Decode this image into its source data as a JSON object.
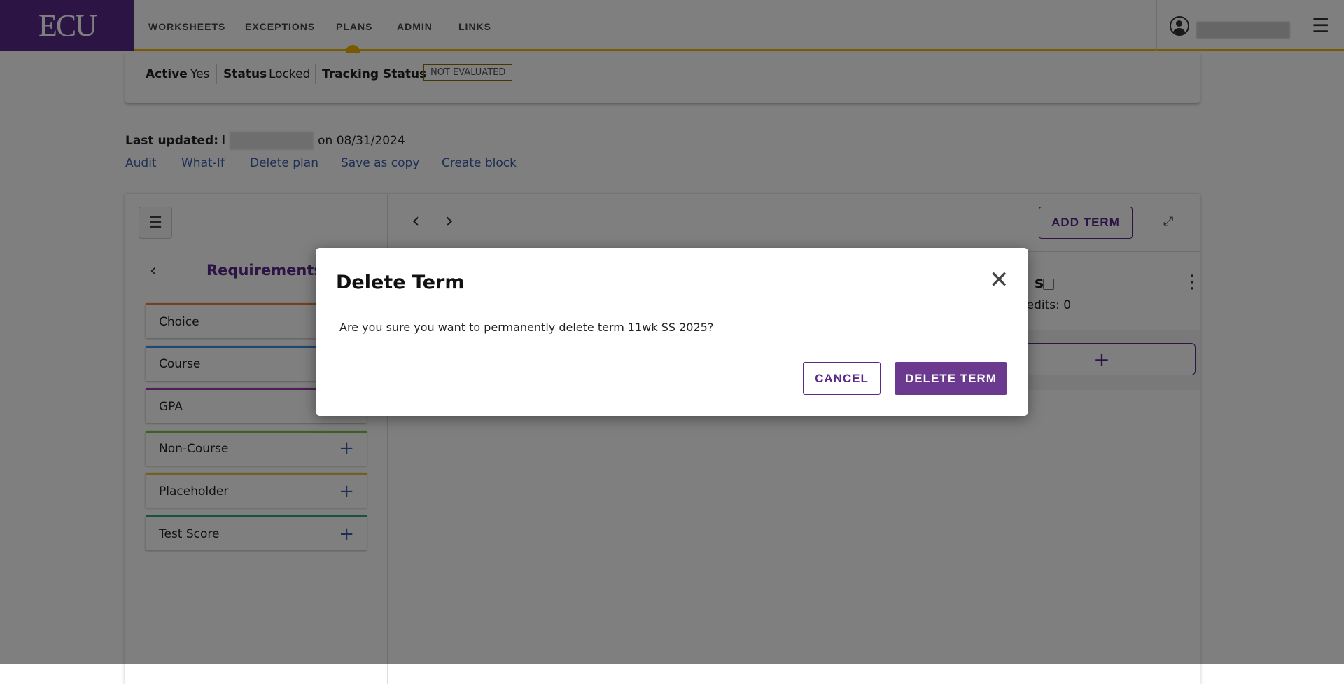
{
  "header": {
    "logo": "ECU",
    "nav": [
      "WORKSHEETS",
      "EXCEPTIONS",
      "PLANS",
      "ADMIN",
      "LINKS"
    ],
    "active_nav": "PLANS"
  },
  "plan": {
    "active_label": "Active",
    "active_value": "Yes",
    "status_label": "Status",
    "status_value": "Locked",
    "tracking_label": "Tracking Status",
    "tracking_value": "NOT EVALUATED"
  },
  "last_updated": {
    "label": "Last updated:",
    "prefix": "l",
    "suffix": "on 08/31/2024"
  },
  "links": [
    "Audit",
    "What-If",
    "Delete plan",
    "Save as copy",
    "Create block"
  ],
  "requirements": {
    "title": "Requirements",
    "items": [
      {
        "label": "Choice",
        "color": "#e8803a"
      },
      {
        "label": "Course",
        "color": "#3a8ee8"
      },
      {
        "label": "GPA",
        "color": "#a03ab0"
      },
      {
        "label": "Non-Course",
        "color": "#7ac04a"
      },
      {
        "label": "Placeholder",
        "color": "#e8c03a"
      },
      {
        "label": "Test Score",
        "color": "#2aa87a"
      }
    ]
  },
  "terms": {
    "add_term": "ADD TERM",
    "partial_title": "s",
    "credits": "redits:  0"
  },
  "dialog": {
    "title": "Delete Term",
    "message": "Are you sure you want to permanently delete term 11wk SS 2025?",
    "cancel": "CANCEL",
    "confirm": "DELETE TERM"
  }
}
